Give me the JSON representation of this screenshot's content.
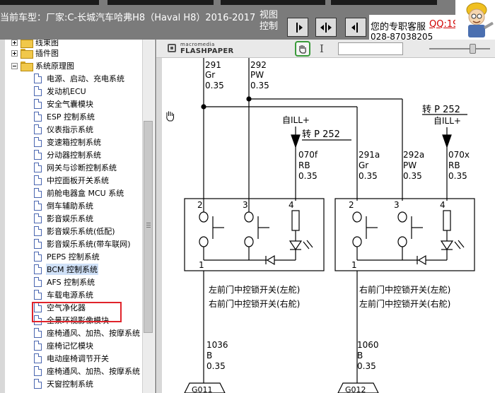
{
  "header": {
    "car_label": "当前车型：厂家:C-长城汽车哈弗H8（Haval H8）2016-2017",
    "view_mode_label": "视图控制",
    "view_buttons": [
      {
        "name": "single-page-view-button",
        "icon": "single-page-icon"
      },
      {
        "name": "two-page-view-button",
        "icon": "two-page-icon"
      },
      {
        "name": "prev-view-button",
        "icon": "arrow-left-icon"
      }
    ],
    "service_label": "您的专职客服",
    "service_qq": "QQ:19",
    "service_phone": "028-87038205"
  },
  "tree": {
    "items": [
      {
        "label": "线束图",
        "level": 0,
        "type": "folder",
        "expander": "plus"
      },
      {
        "label": "插件图",
        "level": 0,
        "type": "folder",
        "expander": "plus"
      },
      {
        "label": "系统原理图",
        "level": 0,
        "type": "folder",
        "expander": "minus"
      },
      {
        "label": "电源、启动、充电系统",
        "level": 1,
        "type": "doc"
      },
      {
        "label": "发动机ECU",
        "level": 1,
        "type": "doc"
      },
      {
        "label": "安全气囊模块",
        "level": 1,
        "type": "doc"
      },
      {
        "label": "ESP 控制系统",
        "level": 1,
        "type": "doc"
      },
      {
        "label": "仪表指示系统",
        "level": 1,
        "type": "doc"
      },
      {
        "label": "变速箱控制系统",
        "level": 1,
        "type": "doc"
      },
      {
        "label": "分动器控制系统",
        "level": 1,
        "type": "doc"
      },
      {
        "label": "网关与诊断控制系统",
        "level": 1,
        "type": "doc"
      },
      {
        "label": "中控面板开关系统",
        "level": 1,
        "type": "doc"
      },
      {
        "label": "前舱电器盒 MCU 系统",
        "level": 1,
        "type": "doc"
      },
      {
        "label": "倒车辅助系统",
        "level": 1,
        "type": "doc"
      },
      {
        "label": "影音娱乐系统",
        "level": 1,
        "type": "doc"
      },
      {
        "label": "影音娱乐系统(低配)",
        "level": 1,
        "type": "doc"
      },
      {
        "label": "影音娱乐系统(带车联网)",
        "level": 1,
        "type": "doc"
      },
      {
        "label": "PEPS 控制系统",
        "level": 1,
        "type": "doc"
      },
      {
        "label": "BCM 控制系统",
        "level": 1,
        "type": "doc",
        "selected": true
      },
      {
        "label": "AFS 控制系统",
        "level": 1,
        "type": "doc"
      },
      {
        "label": "车载电源系统",
        "level": 1,
        "type": "doc"
      },
      {
        "label": "空气净化器",
        "level": 1,
        "type": "doc"
      },
      {
        "label": "全景环视影像模块",
        "level": 1,
        "type": "doc"
      },
      {
        "label": "座椅通风、加热、按摩系统",
        "level": 1,
        "type": "doc"
      },
      {
        "label": "座椅记忆模块",
        "level": 1,
        "type": "doc"
      },
      {
        "label": "电动座椅调节开关",
        "level": 1,
        "type": "doc"
      },
      {
        "label": "座椅通风、加热、按摩系统",
        "level": 1,
        "type": "doc"
      },
      {
        "label": "天窗控制系统",
        "level": 1,
        "type": "doc"
      }
    ]
  },
  "viewer": {
    "brand_vendor": "macromedia",
    "brand_product": "FLASHPAPER",
    "page_input_value": "",
    "zoom_level": 0.72
  },
  "diagram": {
    "top_wires": [
      {
        "num": "291",
        "color": "Gr",
        "size": "0.35"
      },
      {
        "num": "292",
        "color": "PW",
        "size": "0.35"
      }
    ],
    "ill_label": "自ILL+",
    "ref_left": "转 P 252",
    "ref_right": "转 P 252",
    "ill_label_right": "自ILL+",
    "left_ill_wire": {
      "num": "070f",
      "color": "RB",
      "size": "0.35"
    },
    "right_wires": [
      {
        "num": "291a",
        "color": "Gr",
        "size": "0.35"
      },
      {
        "num": "292a",
        "color": "PW",
        "size": "0.35"
      },
      {
        "num": "070x",
        "color": "RB",
        "size": "0.35"
      }
    ],
    "pins": [
      "2",
      "3",
      "4",
      "1"
    ],
    "left_switch": {
      "line1": "左前门中控锁开关(左舵)",
      "line2": "右前门中控锁开关(右舵)"
    },
    "right_switch": {
      "line1": "右前门中控锁开关(左舵)",
      "line2": "左前门中控锁开关(右舵)"
    },
    "ground_wires": [
      {
        "num": "1036",
        "color": "B",
        "size": "0.35",
        "ground": "G011"
      },
      {
        "num": "1060",
        "color": "B",
        "size": "0.35",
        "ground": "G012"
      }
    ]
  }
}
